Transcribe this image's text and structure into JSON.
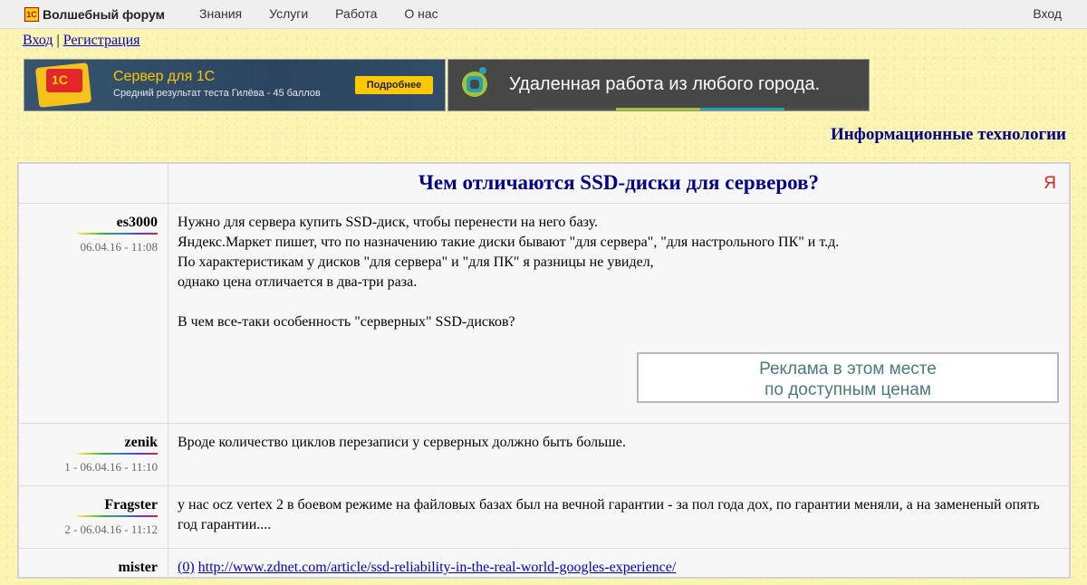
{
  "topbar": {
    "logo_text": "1С",
    "brand": "Волшебный форум",
    "nav": [
      "Знания",
      "Услуги",
      "Работа",
      "О нас"
    ],
    "login": "Вход"
  },
  "auth": {
    "login": "Вход",
    "separator": "|",
    "register": "Регистрация"
  },
  "banners": {
    "banner1": {
      "logo": "1С",
      "title": "Сервер для 1С",
      "subtitle": "Средний результат теста Гилёва - 45 баллов",
      "button": "Подробнее"
    },
    "banner2": {
      "text": "Удаленная работа из любого города.",
      "colors": [
        "#4f4f4f",
        "#9fc43a",
        "#2a9fae",
        "#4f4f4f"
      ]
    }
  },
  "section": {
    "title": "Информационные технологии"
  },
  "topic": {
    "title": "Чем отличаются SSD-диски для серверов?",
    "yandex_icon": "Я"
  },
  "posts": [
    {
      "author": "es3000",
      "date": "06.04.16 - 11:08",
      "lines": [
        "Нужно для сервера купить SSD-диск, чтобы перенести на него базу.",
        "Яндекс.Маркет пишет, что по назначению такие диски бывают \"для сервера\", \"для настрольного ПК\" и т.д.",
        "По характеристикам у дисков \"для сервера\" и \"для ПК\" я разницы не увидел,",
        "однако цена отличается в два-три раза.",
        "",
        "В чем все-таки особенность \"серверных\" SSD-дисков?"
      ],
      "ad": [
        "Реклама в этом месте",
        "по доступным ценам"
      ]
    },
    {
      "author": "zenik",
      "date": "1 - 06.04.16 - 11:10",
      "lines": [
        "Вроде количество циклов перезаписи у серверных должно быть больше."
      ]
    },
    {
      "author": "Fragster",
      "date": "2 - 06.04.16 - 11:12",
      "lines": [
        "у нас ocz vertex 2 в боевом режиме на файловых базах был на вечной гарантии - за пол года дох, по гарантии меняли, а на замененый опять год гарантии...."
      ]
    },
    {
      "author": "mister",
      "ref": "(0)",
      "link": "http://www.zdnet.com/article/ssd-reliability-in-the-real-world-googles-experience/"
    }
  ]
}
